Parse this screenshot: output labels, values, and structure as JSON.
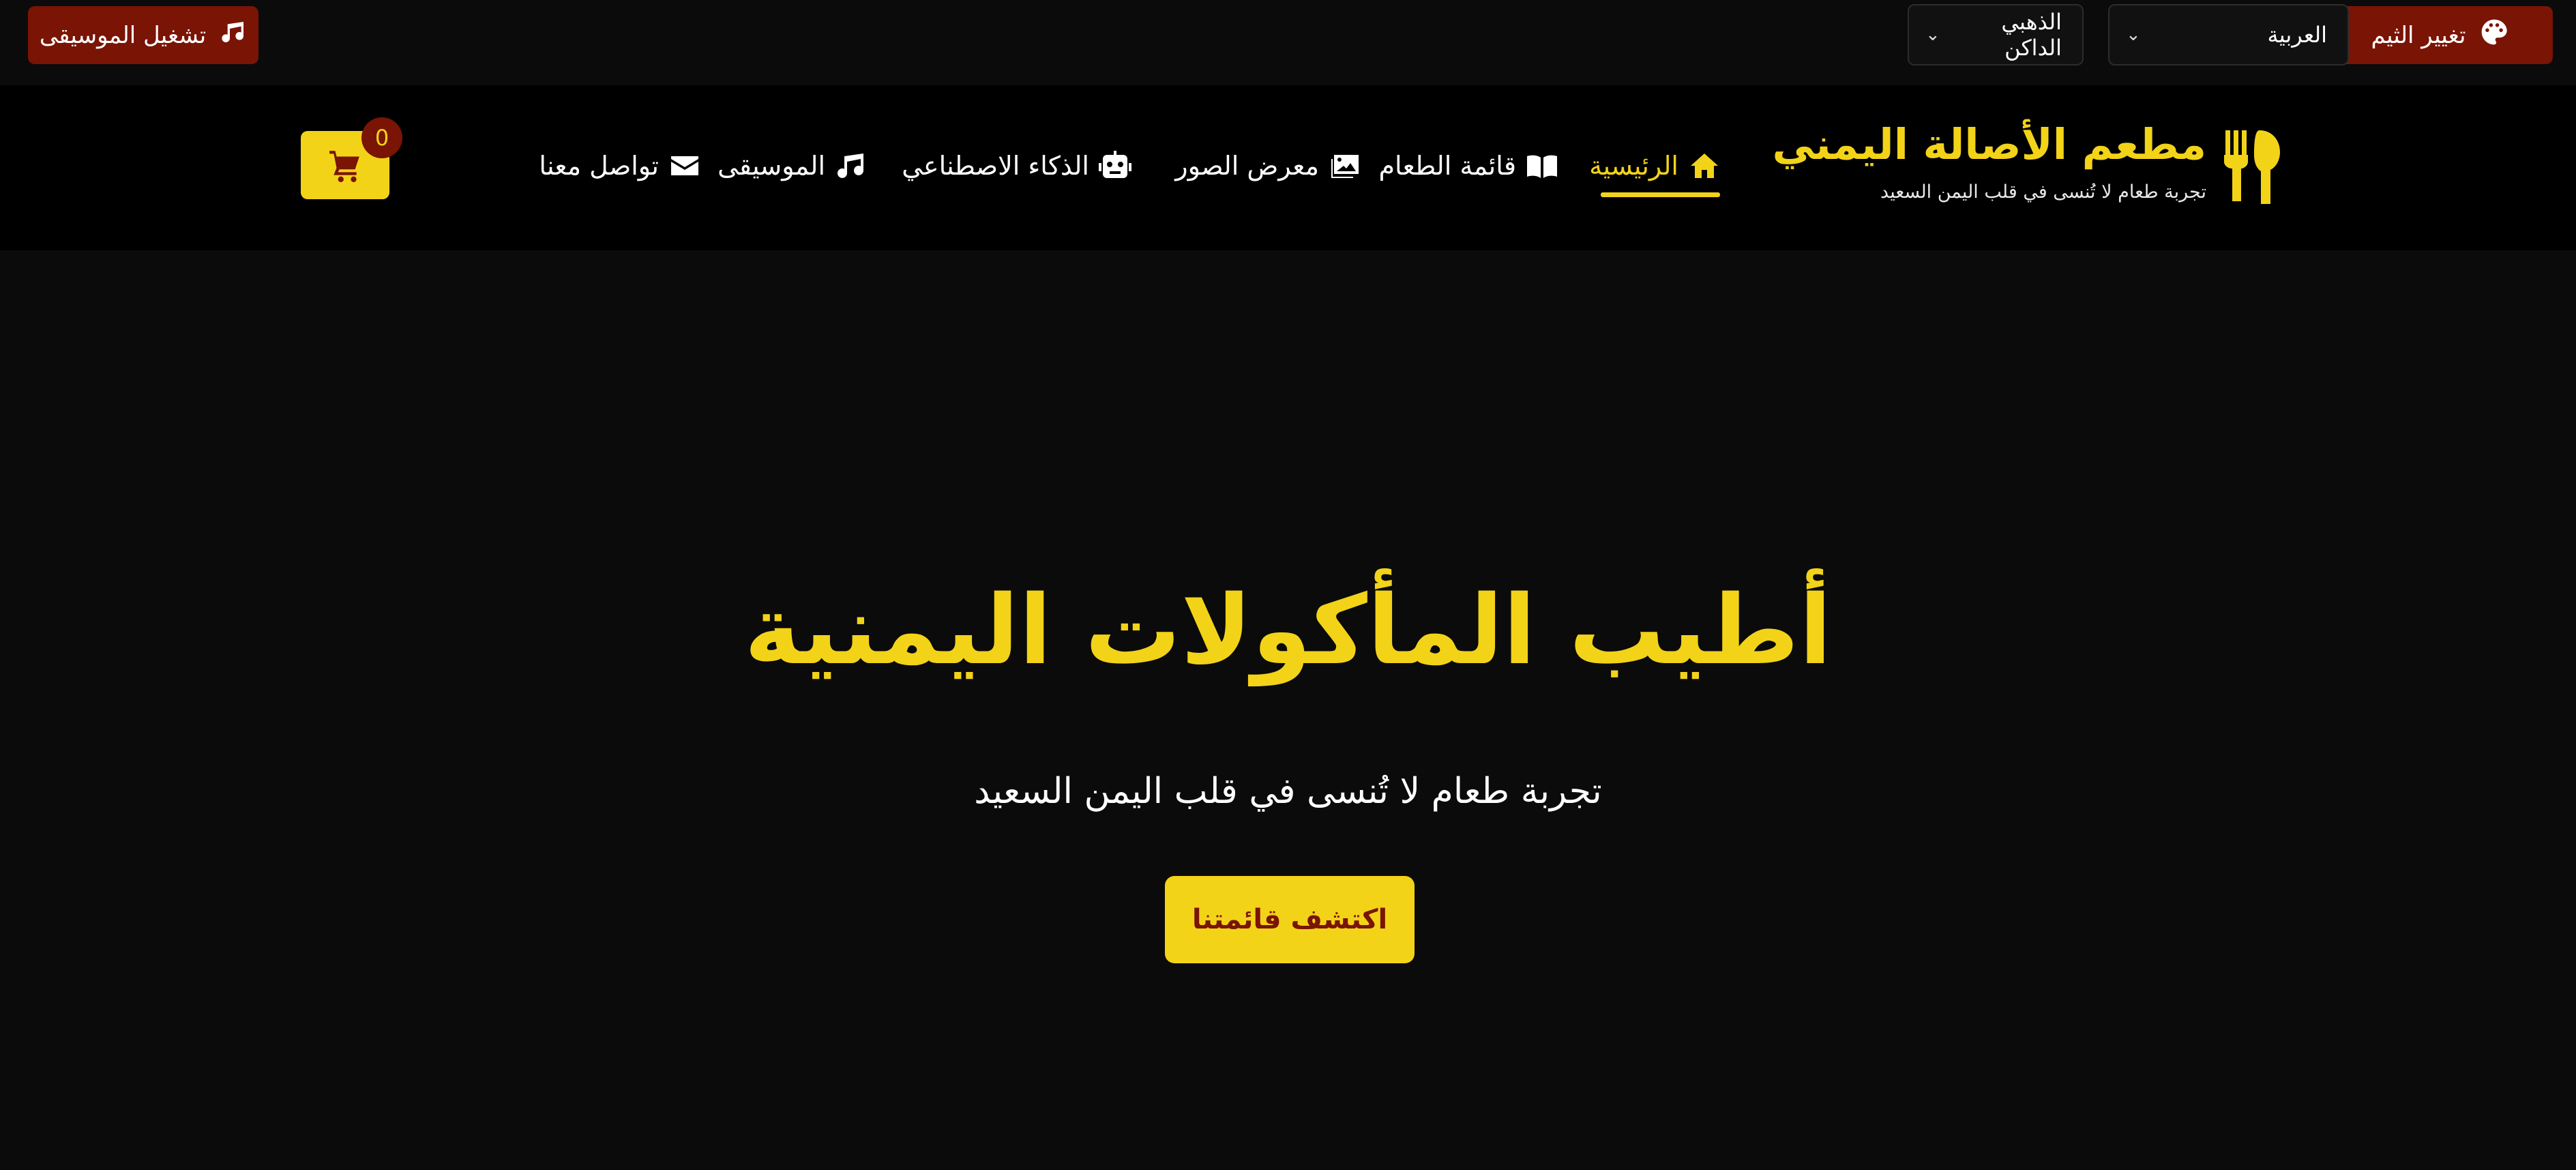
{
  "topbar": {
    "theme_button_label": "تغيير الثيم",
    "language_select_value": "العربية",
    "palette_select_value": "الذهبي الداكن",
    "music_button_label": "تشغيل الموسيقى"
  },
  "brand": {
    "title": "مطعم الأصالة اليمني",
    "subtitle": "تجربة طعام لا تُنسى في قلب اليمن السعيد"
  },
  "nav": {
    "items": [
      {
        "label": "الرئيسية",
        "icon": "home-icon",
        "active": true
      },
      {
        "label": "قائمة الطعام",
        "icon": "book-icon"
      },
      {
        "label": "معرض الصور",
        "icon": "images-icon"
      },
      {
        "label": "الذكاء الاصطناعي",
        "icon": "robot-icon"
      },
      {
        "label": "الموسيقى",
        "icon": "music-icon"
      },
      {
        "label": "تواصل معنا",
        "icon": "envelope-icon"
      }
    ]
  },
  "cart": {
    "count": "0",
    "icon": "cart-icon"
  },
  "hero": {
    "title": "أطيب المأكولات اليمنية",
    "subtitle": "تجربة طعام لا تُنسى في قلب اليمن السعيد",
    "cta_label": "اكتشف قائمتنا"
  },
  "colors": {
    "background": "#0b0b0b",
    "header": "#000000",
    "gold": "#f2d318",
    "maroon": "#7a1405"
  }
}
